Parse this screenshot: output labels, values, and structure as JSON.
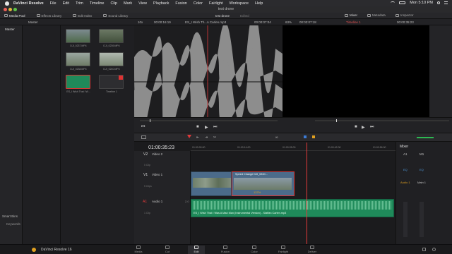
{
  "menubar": {
    "app_name": "DaVinci Resolve",
    "items": [
      "File",
      "Edit",
      "Trim",
      "Timeline",
      "Clip",
      "Mark",
      "View",
      "Playback",
      "Fusion",
      "Color",
      "Fairlight",
      "Workspace",
      "Help"
    ],
    "clock": "Mon 5:10 PM"
  },
  "window": {
    "project_title": "test drone"
  },
  "toolbar": {
    "media_pool": "Media Pool",
    "effects_library": "Effects Library",
    "edit_index": "Edit Index",
    "sound_library": "Sound Library",
    "project_title": "test drone",
    "project_status": "Edited",
    "mixer": "Mixer",
    "metadata": "Metadata",
    "inspector": "Inspector"
  },
  "row2": {
    "bin_name": "Master",
    "zoom": "10x",
    "source_tc": "00:00:16:19",
    "clip_name": "ES_I Wish Th...n Carlen.mp3",
    "source_duration": "00:00:07:04",
    "viewer_zoom": "63%",
    "timeline_duration": "00:03:07:18",
    "timeline_name": "Timeline 1",
    "timeline_tc": "00:00:35:23"
  },
  "sidebar": {
    "master": "Master",
    "smart_bins": "Smart Bins",
    "keywords": "Keywords"
  },
  "media_pool": {
    "items": [
      {
        "label": "DJI_0237.MP4"
      },
      {
        "label": "DJI_0239.MP4"
      },
      {
        "label": "DJI_0238.MP4"
      },
      {
        "label": "DJI_0240.MP4"
      },
      {
        "label": "ES_I Wish That I W..."
      },
      {
        "label": "Timeline 1"
      }
    ]
  },
  "timeline": {
    "current_tc": "01:00:35:23",
    "ruler": [
      "01:00:00:00",
      "01:00:14:00",
      "01:00:28:00",
      "01:00:42:00",
      "01:00:56:00"
    ],
    "tracks": {
      "v2": {
        "id": "V2",
        "name": "Video 2",
        "clips": "0 Clip"
      },
      "v1": {
        "id": "V1",
        "name": "Video 1",
        "clips": "5 Clips"
      },
      "a1": {
        "id": "A1",
        "name": "Audio 1",
        "level": "2.0",
        "clips": "1 Clip"
      }
    },
    "speed_clip_label": "Speed Change  DJI_0240...",
    "speed_percent": "137%",
    "audio_clip_label": "ES_I Wish That I Was A Mad Man (Instrumental Version) - Staffan Carlen.mp3"
  },
  "mixer": {
    "title": "Mixer",
    "channels": [
      "A1",
      "M1"
    ],
    "strips": [
      "Audio 1",
      "Main 1"
    ],
    "eq_labels": [
      "EQ",
      "EQ"
    ]
  },
  "pages": [
    "Media",
    "Cut",
    "Edit",
    "Fusion",
    "Color",
    "Fairlight",
    "Deliver"
  ],
  "branding": {
    "product": "DaVinci Resolve 16"
  },
  "colors": {
    "clip_video": "#4b6b8a",
    "clip_audio": "#1f8a5a",
    "playhead": "#e23a3a",
    "accent_orange": "#e0a020",
    "timeline_name": "#e05050"
  }
}
